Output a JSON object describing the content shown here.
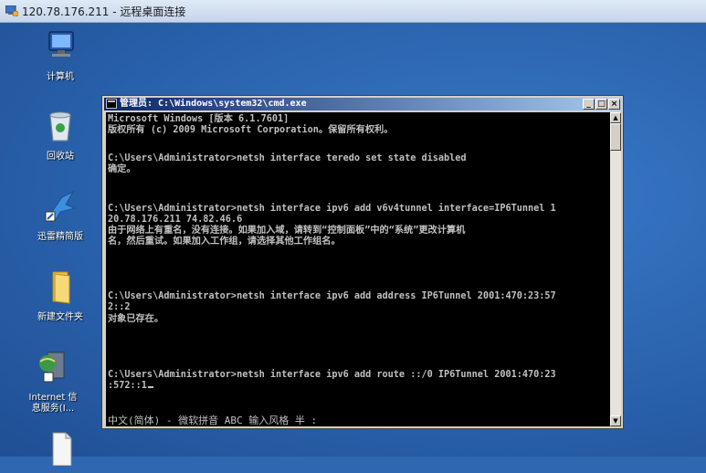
{
  "rdp": {
    "title": "120.78.176.211 - 远程桌面连接"
  },
  "desktop": {
    "icons": [
      {
        "label": "计算机"
      },
      {
        "label": "回收站"
      },
      {
        "label": "迅雷精简版"
      },
      {
        "label": "新建文件夹"
      },
      {
        "label": "Internet 信\n息服务(I..."
      }
    ]
  },
  "cmd": {
    "title": "管理员: C:\\Windows\\system32\\cmd.exe",
    "buttons": {
      "minimize": "_",
      "maximize": "□",
      "close": "×"
    },
    "lines": [
      "Microsoft Windows [版本 6.1.7601]",
      "版权所有 (c) 2009 Microsoft Corporation。保留所有权利。",
      "",
      "C:\\Users\\Administrator>netsh interface teredo set state disabled",
      "确定。",
      "",
      "",
      "C:\\Users\\Administrator>netsh interface ipv6 add v6v4tunnel interface=IP6Tunnel 1",
      "20.78.176.211 74.82.46.6",
      "由于网络上有重名，没有连接。如果加入域，请转到“控制面板”中的“系统”更改计算机",
      "名，然后重试。如果加入工作组，请选择其他工作组名。",
      "",
      "",
      "",
      "",
      "C:\\Users\\Administrator>netsh interface ipv6 add address IP6Tunnel 2001:470:23:57",
      "2::2",
      "对象已存在。",
      "",
      "",
      "",
      "",
      "C:\\Users\\Administrator>netsh interface ipv6 add route ::/0 IP6Tunnel 2001:470:23",
      ":572::1"
    ],
    "ime_status": "中文(简体) - 微软拼音 ABC 输入风格 半 :"
  }
}
